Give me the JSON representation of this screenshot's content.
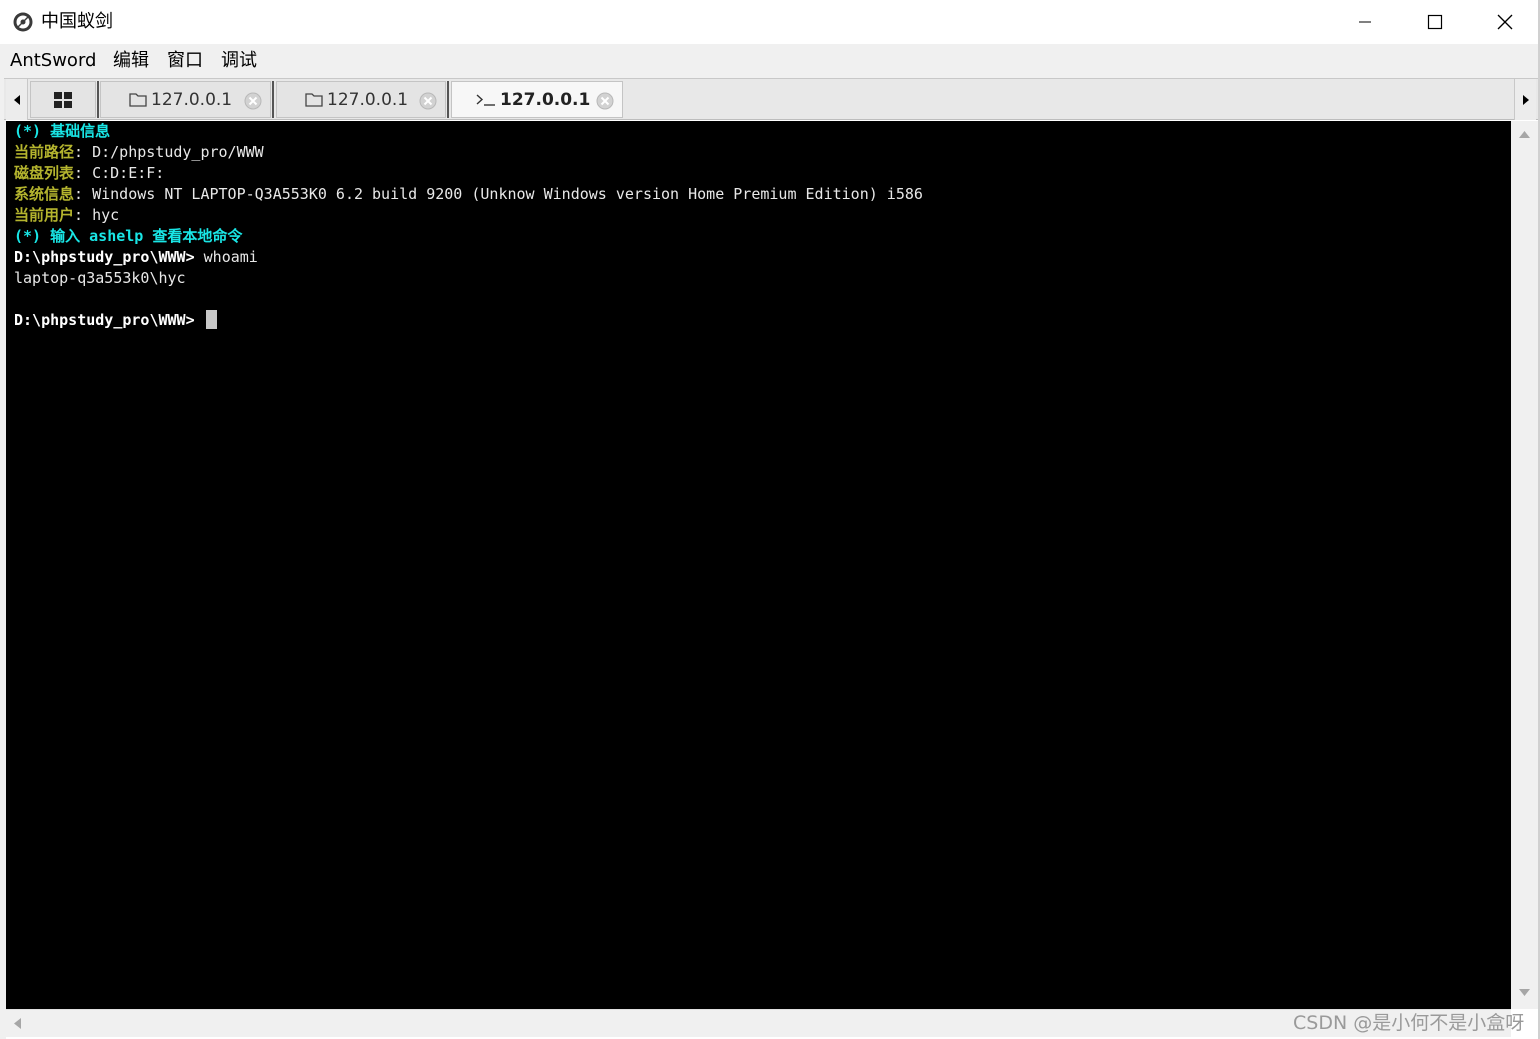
{
  "window": {
    "title": "中国蚁剑",
    "icon": "antsword-logo-icon"
  },
  "menu": {
    "items": [
      "AntSword",
      "编辑",
      "窗口",
      "调试"
    ]
  },
  "tabs": [
    {
      "label": "127.0.0.1",
      "icon": "folder-icon",
      "active": false
    },
    {
      "label": "127.0.0.1",
      "icon": "folder-icon",
      "active": false
    },
    {
      "label": "127.0.0.1",
      "icon": "terminal-icon",
      "active": true
    }
  ],
  "terminal": {
    "info_header": "(*) 基础信息",
    "rows": [
      {
        "label": "当前路径",
        "value": " D:/phpstudy_pro/WWW"
      },
      {
        "label": "磁盘列表",
        "value": " C:D:E:F:"
      },
      {
        "label": "系统信息",
        "value": " Windows NT LAPTOP-Q3A553K0 6.2 build 9200 (Unknow Windows version Home Premium Edition) i586"
      },
      {
        "label": "当前用户",
        "value": " hyc"
      }
    ],
    "colon": ":",
    "help_hint": {
      "prefix": "(*) 输入 ",
      "command": "ashelp",
      "suffix": " 查看本地命令"
    },
    "prompt": "D:\\phpstudy_pro\\WWW>",
    "command": " whoami",
    "output": "laptop-q3a553k0\\hyc",
    "prompt2": "D:\\phpstudy_pro\\WWW>"
  },
  "watermark": "CSDN @是小何不是小盒呀",
  "colors": {
    "terminal_bg": "#000000",
    "cyan": "#19e6e6",
    "olive": "#b4b42e"
  }
}
